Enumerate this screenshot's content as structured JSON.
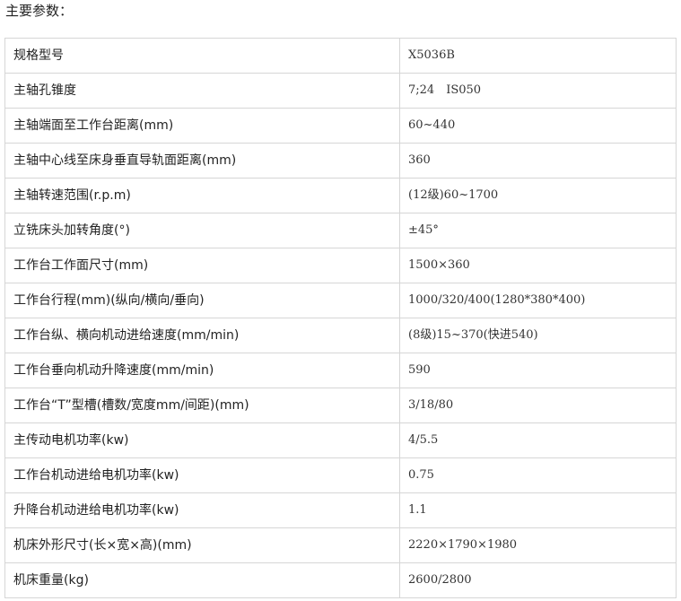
{
  "heading": "主要参数：",
  "specs": [
    {
      "label": "规格型号",
      "value": "X5036B"
    },
    {
      "label": "主轴孔锥度",
      "value": "7;24　IS050"
    },
    {
      "label": "主轴端面至工作台距离(mm)",
      "value": "60~440"
    },
    {
      "label": "主轴中心线至床身垂直导轨面距离(mm)",
      "value": "360"
    },
    {
      "label": "主轴转速范围(r.p.m)",
      "value": "(12级)60~1700"
    },
    {
      "label": "立铣床头加转角度(°)",
      "value": "±45°"
    },
    {
      "label": "工作台工作面尺寸(mm)",
      "value": "1500×360"
    },
    {
      "label": "工作台行程(mm)(纵向/横向/垂向)",
      "value": "1000/320/400(1280*380*400)"
    },
    {
      "label": "工作台纵、横向机动进给速度(mm/min)",
      "value": "(8级)15~370(快进540)"
    },
    {
      "label": "工作台垂向机动升降速度(mm/min)",
      "value": "590"
    },
    {
      "label": "工作台“T”型槽(槽数/宽度mm/间距)(mm)",
      "value": "3/18/80"
    },
    {
      "label": "主传动电机功率(kw)",
      "value": "4/5.5"
    },
    {
      "label": "工作台机动进给电机功率(kw)",
      "value": "0.75"
    },
    {
      "label": "升降台机动进给电机功率(kw)",
      "value": "1.1"
    },
    {
      "label": "机床外形尺寸(长×宽×高)(mm)",
      "value": "2220×1790×1980"
    },
    {
      "label": "机床重量(kg)",
      "value": "2600/2800"
    }
  ]
}
